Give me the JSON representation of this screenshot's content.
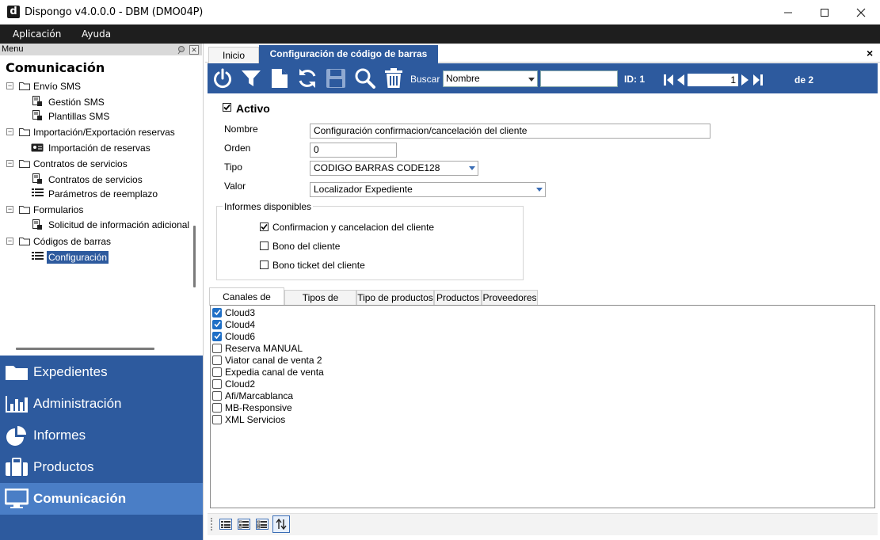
{
  "window": {
    "logo_letter": "d",
    "title": "Dispongo v4.0.0.0 - DBM (DMO04P)"
  },
  "menubar": {
    "items": [
      "Aplicación",
      "Ayuda"
    ]
  },
  "left_panel": {
    "header": "Menu",
    "section_title": "Comunicación",
    "tree": {
      "envio_sms": "Envío SMS",
      "gestion_sms": "Gestión SMS",
      "plantillas_sms": "Plantillas SMS",
      "import_export": "Importación/Exportación reservas",
      "importacion_reservas": "Importación de reservas",
      "contratos_servicios": "Contratos de servicios",
      "contratos_servicios_child": "Contratos de servicios",
      "parametros_reemplazo": "Parámetros de reemplazo",
      "formularios": "Formularios",
      "solicitud_info": "Solicitud de información adicional",
      "codigos_barras": "Códigos de barras",
      "configuracion": "Configuración"
    },
    "nav": {
      "expedientes": "Expedientes",
      "administracion": "Administración",
      "informes": "Informes",
      "productos": "Productos",
      "comunicacion": "Comunicación"
    }
  },
  "document": {
    "tabs": {
      "inicio": "Inicio",
      "config": "Configuración de código de barras"
    },
    "close_glyph": "×",
    "toolbar": {
      "buscar_label": "Buscar",
      "buscar_field": "Nombre",
      "buscar_value": "",
      "id_label": "ID: 1",
      "page_value": "1",
      "page_total": "de 2"
    },
    "form": {
      "activo_label": "Activo",
      "activo_checked": true,
      "nombre_label": "Nombre",
      "nombre_value": "Configuración confirmacion/cancelación del cliente",
      "orden_label": "Orden",
      "orden_value": "0",
      "tipo_label": "Tipo",
      "tipo_value": "CODIGO BARRAS CODE128",
      "valor_label": "Valor",
      "valor_value": "Localizador Expediente",
      "informes_legend": "Informes disponibles",
      "informes": [
        {
          "label": "Confirmacion y cancelacion del cliente",
          "checked": true
        },
        {
          "label": "Bono del cliente",
          "checked": false
        },
        {
          "label": "Bono ticket del cliente",
          "checked": false
        }
      ]
    },
    "lower_tabs": [
      "Canales de venta",
      "Tipos de servicio",
      "Tipo de productos",
      "Productos",
      "Proveedores"
    ],
    "canales": [
      {
        "label": "Cloud3",
        "checked": true
      },
      {
        "label": "Cloud4",
        "checked": true
      },
      {
        "label": "Cloud6",
        "checked": true
      },
      {
        "label": "Reserva MANUAL",
        "checked": false
      },
      {
        "label": "Viator canal de venta 2",
        "checked": false
      },
      {
        "label": "Expedia canal de venta",
        "checked": false
      },
      {
        "label": "Cloud2",
        "checked": false
      },
      {
        "label": "Afi/Marcablanca",
        "checked": false
      },
      {
        "label": "MB-Responsive",
        "checked": false
      },
      {
        "label": "XML Servicios",
        "checked": false
      }
    ]
  },
  "colors": {
    "accent": "#2d5a9e",
    "nav_active": "#4a7ec6",
    "check_blue": "#1f6fc6"
  }
}
